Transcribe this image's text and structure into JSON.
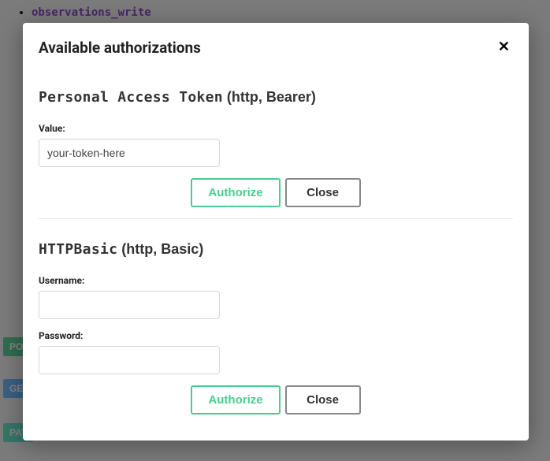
{
  "background": {
    "list_item_code": "observations_write",
    "badge_post": "PO",
    "badge_get": "GE",
    "badge_patch": "PAT"
  },
  "modal": {
    "title": "Available authorizations",
    "close_x": "✕"
  },
  "scheme1": {
    "name": "Personal Access Token",
    "detail": " (http, Bearer)",
    "value_label": "Value:",
    "value": "your-token-here",
    "authorize": "Authorize",
    "close": "Close"
  },
  "scheme2": {
    "name": "HTTPBasic",
    "detail": " (http, Basic)",
    "username_label": "Username:",
    "username": "",
    "password_label": "Password:",
    "password": "",
    "authorize": "Authorize",
    "close": "Close"
  }
}
